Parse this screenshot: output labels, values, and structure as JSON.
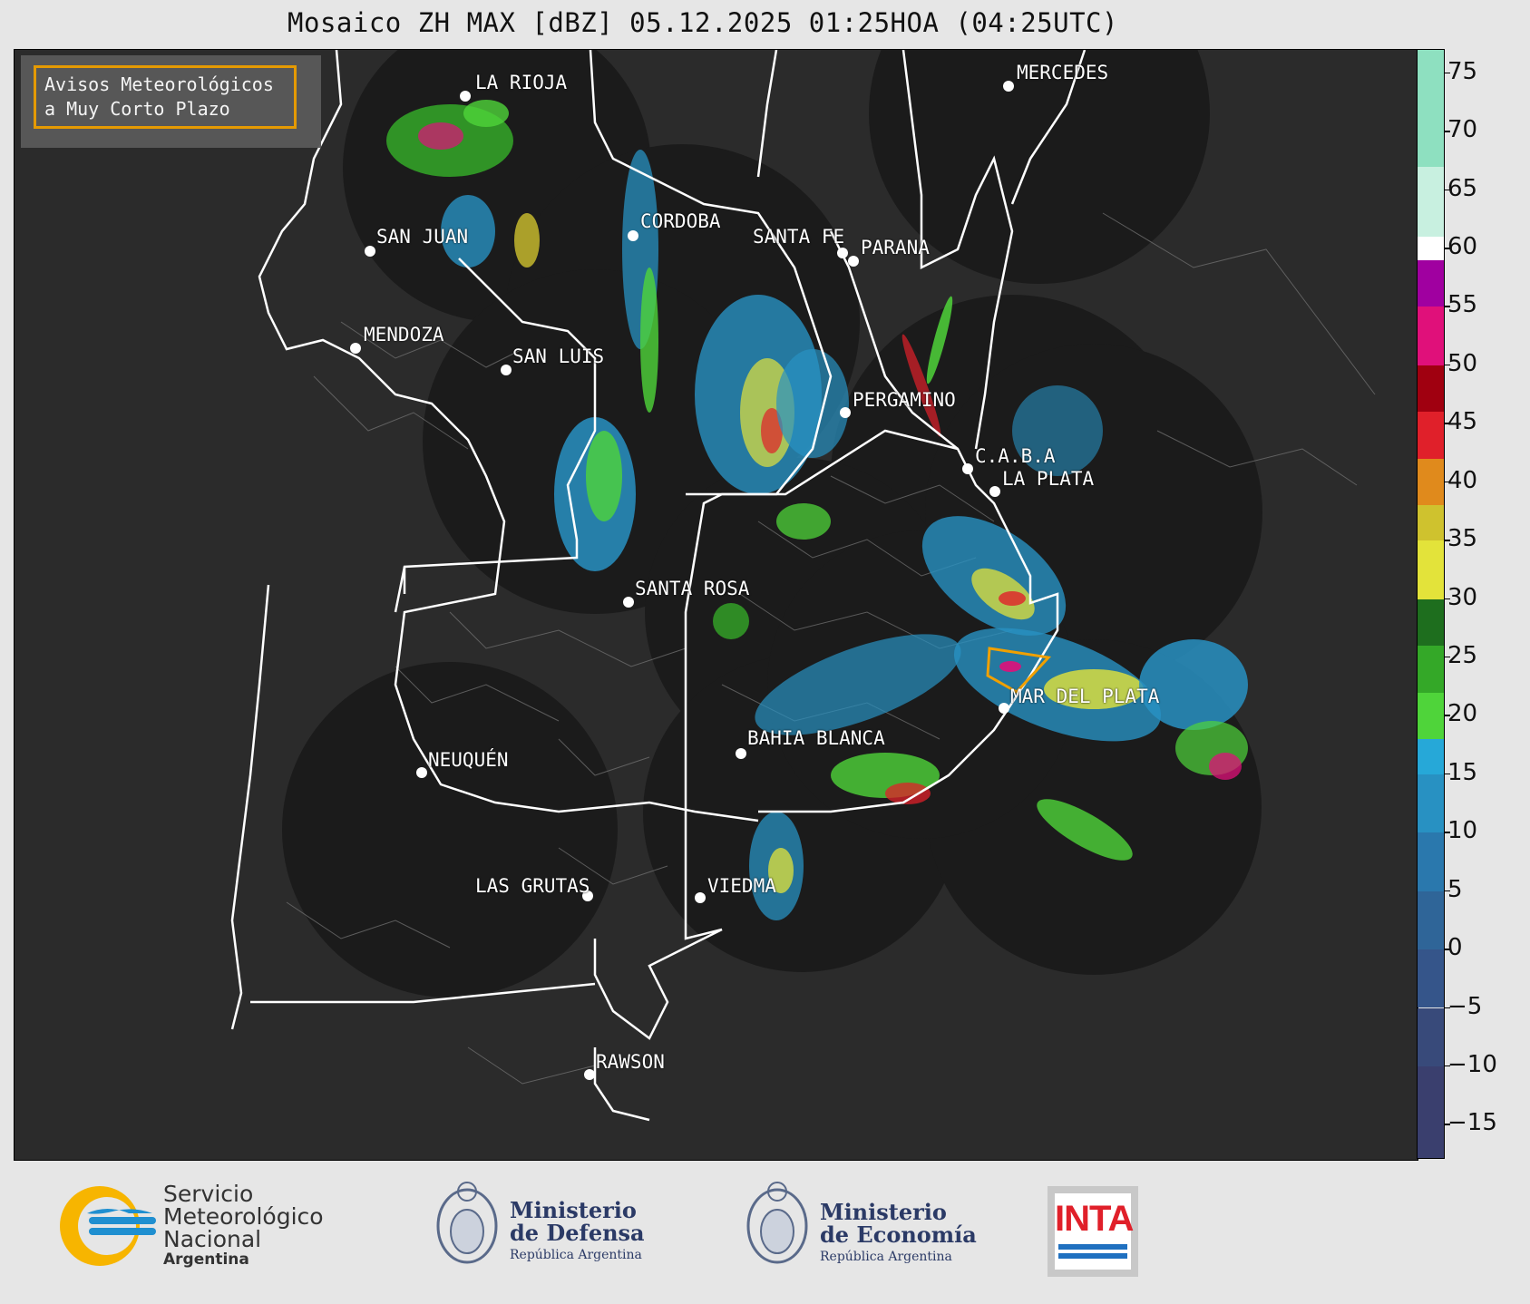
{
  "title": "Mosaico ZH MAX [dBZ] 05.12.2025 01:25HOA (04:25UTC)",
  "alert_box": {
    "line1": "Avisos Meteorológicos",
    "line2": "a Muy Corto Plazo",
    "border_color": "#f0a000"
  },
  "cities": [
    {
      "name": "LA RIOJA"
    },
    {
      "name": "SAN JUAN"
    },
    {
      "name": "CORDOBA"
    },
    {
      "name": "SANTA FE"
    },
    {
      "name": "PARANA"
    },
    {
      "name": "MENDOZA"
    },
    {
      "name": "SAN LUIS"
    },
    {
      "name": "PERGAMINO"
    },
    {
      "name": "C.A.B.A"
    },
    {
      "name": "LA PLATA"
    },
    {
      "name": "SANTA ROSA"
    },
    {
      "name": "MAR DEL PLATA"
    },
    {
      "name": "BAHIA BLANCA"
    },
    {
      "name": "NEUQUÉN"
    },
    {
      "name": "LAS GRUTAS"
    },
    {
      "name": "VIEDMA"
    },
    {
      "name": "RAWSON"
    },
    {
      "name": "MERCEDES"
    }
  ],
  "colorbar": {
    "unit": "dBZ",
    "min": -18,
    "max": 77,
    "ticks": [
      "75",
      "70",
      "65",
      "60",
      "55",
      "50",
      "45",
      "40",
      "35",
      "30",
      "25",
      "20",
      "15",
      "10",
      "5",
      "0",
      "−5",
      "−10",
      "−15"
    ],
    "tick_values": [
      75,
      70,
      65,
      60,
      55,
      50,
      45,
      40,
      35,
      30,
      25,
      20,
      15,
      10,
      5,
      0,
      -5,
      -10,
      -15
    ],
    "bands": [
      {
        "from": -18,
        "to": -10,
        "color": "#3a3f6e"
      },
      {
        "from": -10,
        "to": -5,
        "color": "#384a7a"
      },
      {
        "from": -5,
        "to": 0,
        "color": "#35558a"
      },
      {
        "from": 0,
        "to": 5,
        "color": "#2f6598"
      },
      {
        "from": 5,
        "to": 10,
        "color": "#2a78ad"
      },
      {
        "from": 10,
        "to": 15,
        "color": "#2891c2"
      },
      {
        "from": 15,
        "to": 18,
        "color": "#26a8d8"
      },
      {
        "from": 18,
        "to": 22,
        "color": "#4fd43a"
      },
      {
        "from": 22,
        "to": 26,
        "color": "#34a828"
      },
      {
        "from": 26,
        "to": 30,
        "color": "#1e6e1e"
      },
      {
        "from": 30,
        "to": 35,
        "color": "#e3e33a"
      },
      {
        "from": 35,
        "to": 38,
        "color": "#cfc22e"
      },
      {
        "from": 38,
        "to": 42,
        "color": "#e08a1c"
      },
      {
        "from": 42,
        "to": 46,
        "color": "#e0202a"
      },
      {
        "from": 46,
        "to": 50,
        "color": "#a00010"
      },
      {
        "from": 50,
        "to": 55,
        "color": "#e0107a"
      },
      {
        "from": 55,
        "to": 59,
        "color": "#a000a0"
      },
      {
        "from": 59,
        "to": 61,
        "color": "#ffffff"
      },
      {
        "from": 61,
        "to": 67,
        "color": "#c8f0e0"
      },
      {
        "from": 67,
        "to": 77,
        "color": "#8ee0c0"
      }
    ]
  },
  "footer": {
    "smn_line1": "Servicio",
    "smn_line2": "Meteorológico",
    "smn_line3": "Nacional",
    "smn_line4": "Argentina",
    "defensa_line1": "Ministerio",
    "defensa_line2": "de Defensa",
    "defensa_line3": "República Argentina",
    "economia_line1": "Ministerio",
    "economia_line2": "de Economía",
    "economia_line3": "República Argentina",
    "inta": "INTA"
  },
  "colors": {
    "map_background": "#2b2b2b",
    "radar_coverage": "#1b1b1b",
    "province_border": "#ffffff",
    "warning_polygon": "#f0a000"
  }
}
